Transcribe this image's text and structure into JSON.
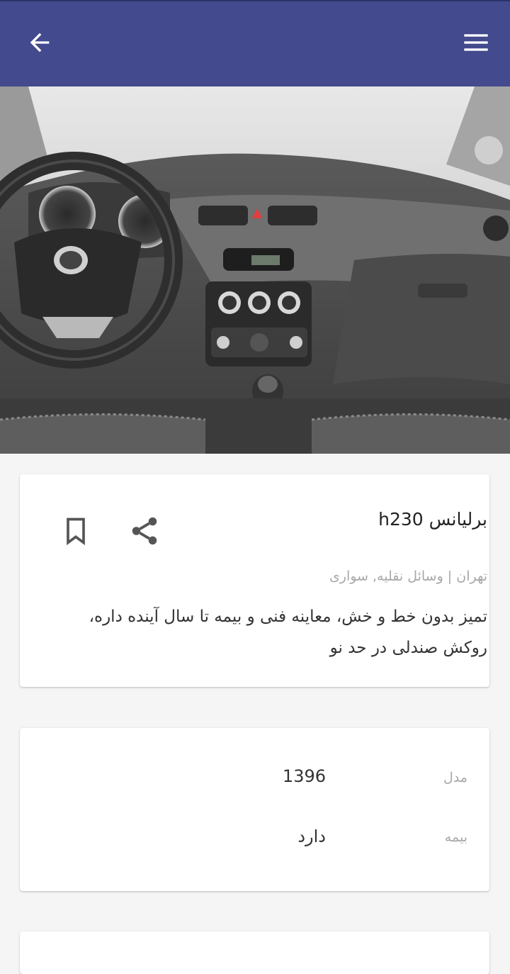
{
  "appbar": {
    "color": "#434a8e",
    "back_icon": "arrow-left-icon",
    "menu_icon": "hamburger-menu-icon"
  },
  "hero": {
    "image": "car-interior-dashboard-photo"
  },
  "listing": {
    "title": "برلیانس h230",
    "location_category": "تهران | وسائل نقلیه, سواری",
    "description": "تمیز بدون خط و خش، معاینه فنی و بیمه تا سال آینده داره، روکش صندلی در حد نو",
    "bookmark_icon": "bookmark-icon",
    "share_icon": "share-icon"
  },
  "specs": [
    {
      "label": "مدل",
      "value": "1396"
    },
    {
      "label": "بیمه",
      "value": "دارد"
    }
  ]
}
